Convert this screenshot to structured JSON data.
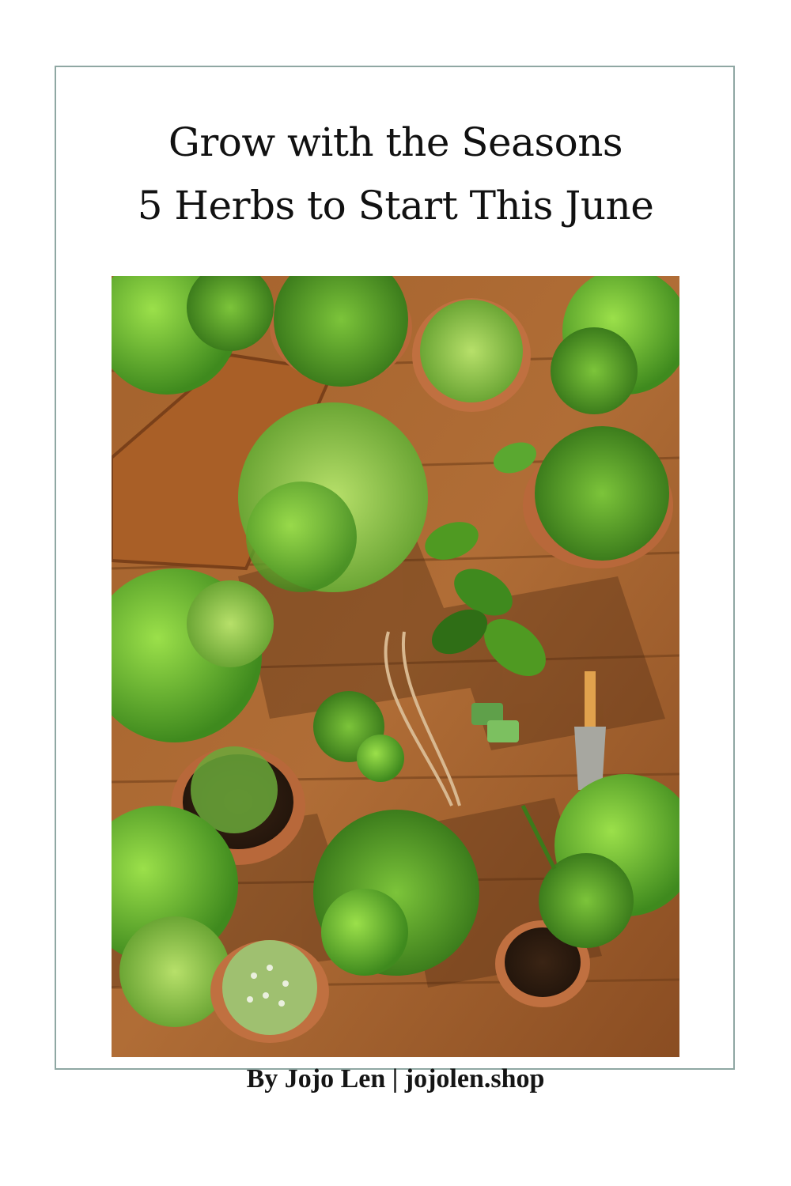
{
  "title": {
    "line1": "Grow with the Seasons",
    "line2": "5 Herbs to Start This June"
  },
  "byline": "By Jojo Len | jojolen.shop",
  "colors": {
    "frame_border": "#8fa7a3",
    "background": "#ffffff",
    "text": "#111111",
    "wood": "#9a5a2a",
    "leaf": "#5aa830",
    "pot": "#b8683a"
  }
}
